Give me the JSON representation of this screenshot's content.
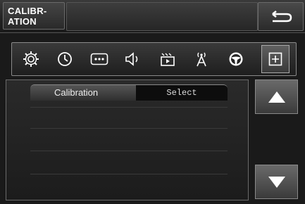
{
  "header": {
    "title_line1": "CALIBR-",
    "title_line2": "ATION",
    "back_icon": "back-arrow-icon"
  },
  "toolbar": {
    "icons": [
      {
        "name": "settings-gear-icon"
      },
      {
        "name": "clock-icon"
      },
      {
        "name": "dots-icon"
      },
      {
        "name": "speaker-icon"
      },
      {
        "name": "video-icon"
      },
      {
        "name": "antenna-icon"
      },
      {
        "name": "steering-wheel-icon"
      },
      {
        "name": "plus-icon",
        "active": true
      }
    ]
  },
  "list": {
    "rows": [
      {
        "label": "Calibration",
        "value": "Select"
      }
    ]
  },
  "scroll": {
    "up_icon": "up-triangle-icon",
    "down_icon": "down-triangle-icon"
  },
  "colors": {
    "background": "#1a1a1a",
    "text": "#ffffff"
  }
}
